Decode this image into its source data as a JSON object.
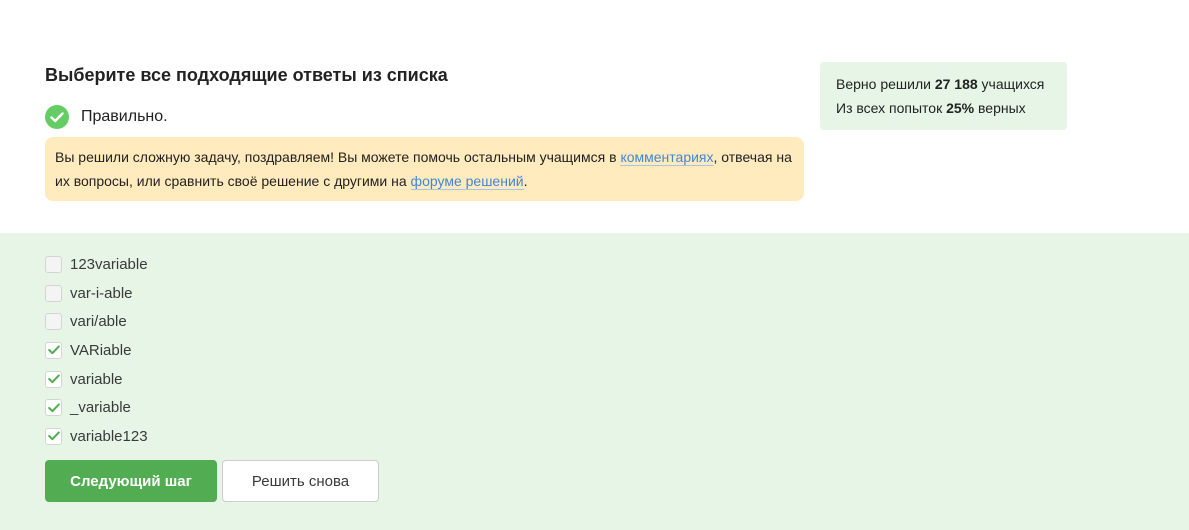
{
  "question": {
    "title": "Выберите все подходящие ответы из списка"
  },
  "status": {
    "icon": "check-circle-icon",
    "label": "Правильно.",
    "color": "#66cc66"
  },
  "hint": {
    "text_before": "Вы решили сложную задачу, поздравляем! Вы можете помочь остальным учащимся в ",
    "comments_link": "комментариях",
    "text_middle": ", отвечая на их вопросы, или сравнить своё решение с другими на ",
    "forum_link": "форуме решений",
    "text_after": "."
  },
  "stats": {
    "solved_prefix": "Верно решили ",
    "solved_count": "27 188",
    "solved_suffix": " учащихся",
    "attempts_prefix": "Из всех попыток ",
    "attempts_percent": "25%",
    "attempts_suffix": " верных"
  },
  "options": [
    {
      "label": "123variable",
      "checked": false
    },
    {
      "label": "var-i-able",
      "checked": false
    },
    {
      "label": "vari/able",
      "checked": false
    },
    {
      "label": "VARiable",
      "checked": true
    },
    {
      "label": "variable",
      "checked": true
    },
    {
      "label": "_variable",
      "checked": true
    },
    {
      "label": "variable123",
      "checked": true
    }
  ],
  "buttons": {
    "next": "Следующий шаг",
    "retry": "Решить снова"
  },
  "colors": {
    "accent_green": "#52ad52",
    "answer_bg": "#e6f5e6",
    "hint_bg": "#ffebbd",
    "link": "#4485d6"
  }
}
